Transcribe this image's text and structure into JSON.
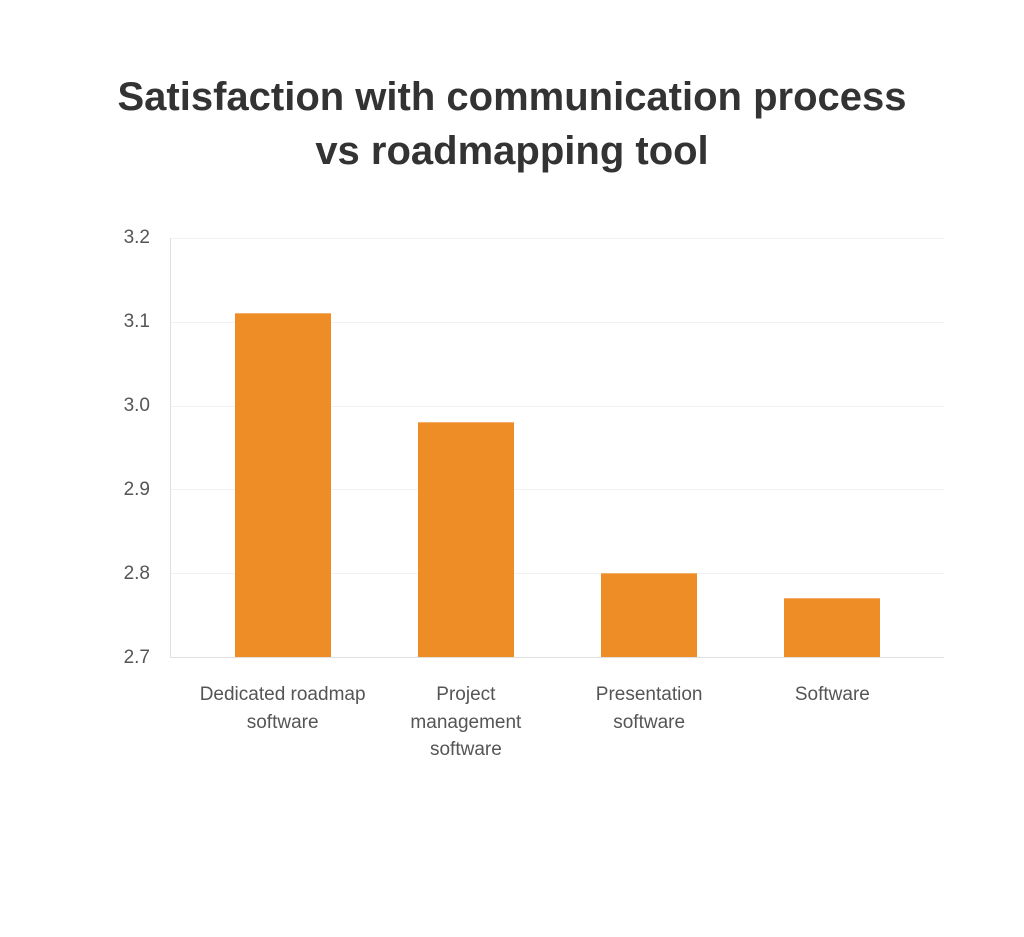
{
  "chart_data": {
    "type": "bar",
    "title": "Satisfaction with communication process vs roadmapping tool",
    "categories": [
      "Dedicated roadmap software",
      "Project management software",
      "Presentation software",
      "Software"
    ],
    "values": [
      3.11,
      2.98,
      2.8,
      2.77
    ],
    "xlabel": "",
    "ylabel": "",
    "ylim": [
      2.7,
      3.2
    ],
    "yticks": [
      2.7,
      2.8,
      2.9,
      3.0,
      3.1,
      3.2
    ],
    "ytick_labels": [
      "2.7",
      "2.8",
      "2.9",
      "3.0",
      "3.1",
      "3.2"
    ],
    "bar_color": "#ee8c26",
    "legend": false
  }
}
